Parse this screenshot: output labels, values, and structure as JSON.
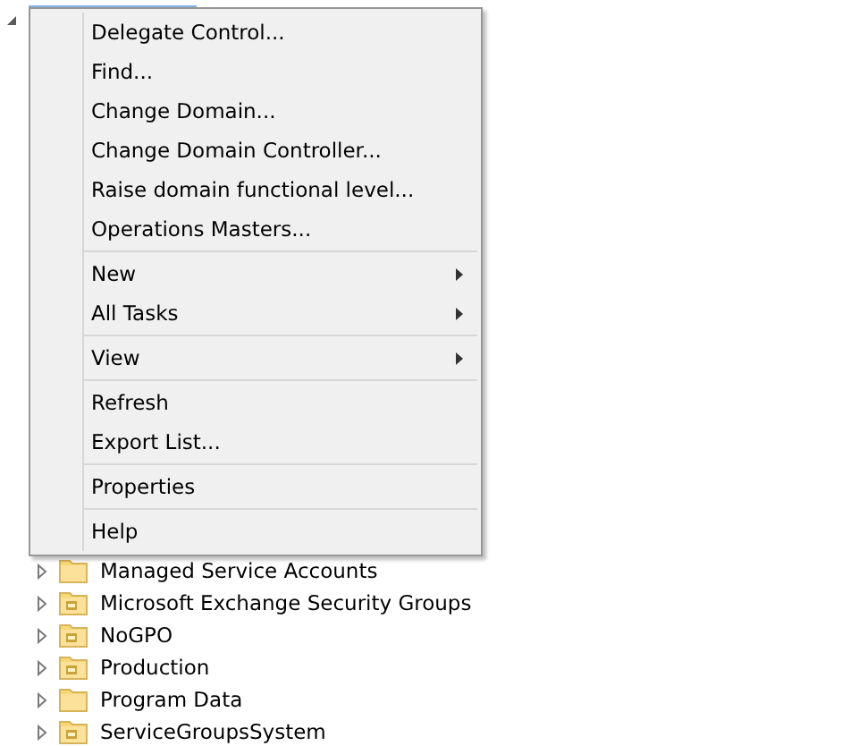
{
  "tree": {
    "root": {
      "expanded": true,
      "selected": true
    },
    "children": [
      {
        "label": "Managed Service Accounts",
        "kind": "folder",
        "expanded": false
      },
      {
        "label": "Microsoft Exchange Security Groups",
        "kind": "ou",
        "expanded": false
      },
      {
        "label": "NoGPO",
        "kind": "ou",
        "expanded": false
      },
      {
        "label": "Production",
        "kind": "ou",
        "expanded": false
      },
      {
        "label": "Program Data",
        "kind": "folder",
        "expanded": false
      },
      {
        "label": "ServiceGroupsSystem",
        "kind": "ou",
        "expanded": false
      }
    ]
  },
  "context_menu": {
    "groups": [
      [
        {
          "label": "Delegate Control...",
          "submenu": false
        },
        {
          "label": "Find...",
          "submenu": false
        },
        {
          "label": "Change Domain...",
          "submenu": false
        },
        {
          "label": "Change Domain Controller...",
          "submenu": false
        },
        {
          "label": "Raise domain functional level...",
          "submenu": false
        },
        {
          "label": "Operations Masters...",
          "submenu": false
        }
      ],
      [
        {
          "label": "New",
          "submenu": true
        },
        {
          "label": "All Tasks",
          "submenu": true
        }
      ],
      [
        {
          "label": "View",
          "submenu": true
        }
      ],
      [
        {
          "label": "Refresh",
          "submenu": false
        },
        {
          "label": "Export List...",
          "submenu": false
        }
      ],
      [
        {
          "label": "Properties",
          "submenu": false
        }
      ],
      [
        {
          "label": "Help",
          "submenu": false
        }
      ]
    ]
  }
}
